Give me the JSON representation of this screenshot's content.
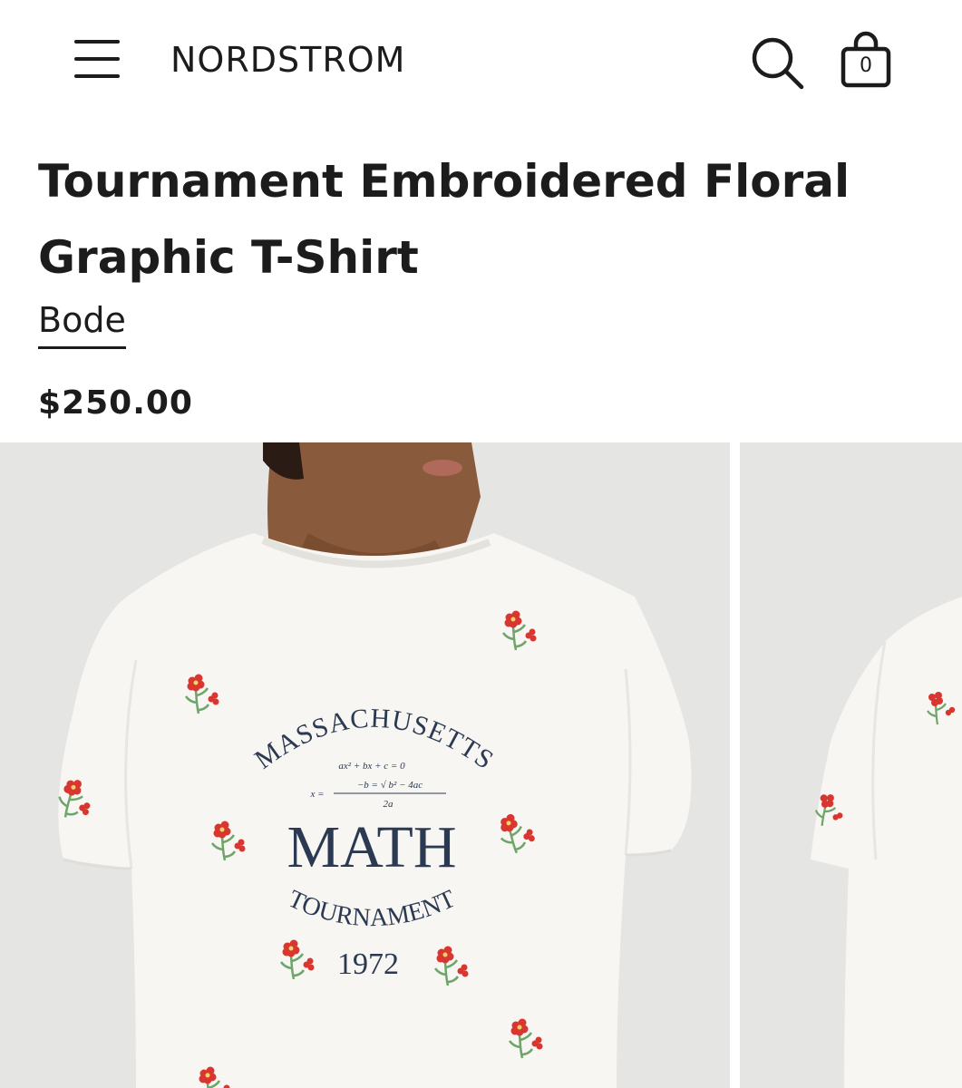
{
  "header": {
    "menu_icon": "hamburger-menu-icon",
    "logo": "NORDSTROM",
    "search_icon": "search-icon",
    "bag_icon": "shopping-bag-icon",
    "bag_count": "0"
  },
  "product": {
    "title": "Tournament Embroidered Floral Graphic T-Shirt",
    "brand": "Bode",
    "price": "$250.00"
  },
  "graphic": {
    "arc_top": "MASSACHUSETTS",
    "formula_line1": "ax² + bx + c = 0",
    "formula_line2": "−b = √ b² − 4ac",
    "formula_x": "x =",
    "formula_denominator": "2a",
    "main_word": "MATH",
    "arc_bottom": "TOURNAMENT",
    "year": "1972"
  },
  "colors": {
    "text": "#1c1c1c",
    "photo_background": "#e5e5e3",
    "shirt": "#f7f6f2",
    "print_navy": "#2b3a52",
    "flower_red": "#d9362f",
    "leaf_green": "#6fa56a"
  }
}
